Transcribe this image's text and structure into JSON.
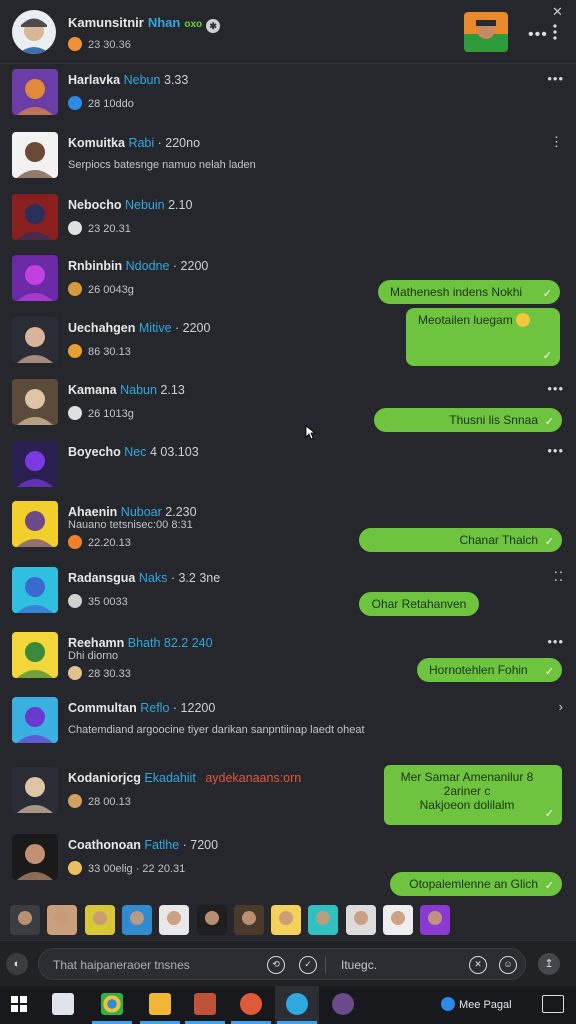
{
  "header": {
    "name": "Kamunsitnir",
    "name_highlight": "Nhan",
    "badge": "oxo",
    "subtitle": "23 30.36",
    "more": "•••",
    "close": "✕"
  },
  "conversations": [
    {
      "name": "Harlavka",
      "highlight": "Nebun",
      "time": "3.33",
      "preview": "28 10ddo",
      "color_a": "#6a3ea6",
      "color_b": "#e08a3a",
      "icon_color": "#2d8ae6",
      "more": "•••"
    },
    {
      "name": "Komuitka",
      "highlight": "Rabi",
      "time": "· 220no",
      "preview": "Serpiocs batesnge namuo nelah laden",
      "color_a": "#f2f2f2",
      "color_b": "#6b4a35",
      "icon_color": "",
      "more": "⋮"
    },
    {
      "name": "Nebocho",
      "highlight": "Nebuin",
      "time": "2.10",
      "preview": "23 20.31",
      "color_a": "#8a1f1f",
      "color_b": "#2c2f5e",
      "icon_color": "#e0e0e0",
      "more": ""
    },
    {
      "name": "Rnbinbin",
      "highlight": "Ndodne",
      "time": "· 2200",
      "preview": "26 0043g",
      "color_a": "#6a2aa6",
      "color_b": "#c040e0",
      "icon_color": "#d79a3a",
      "more": ""
    },
    {
      "name": "Uechahgen",
      "highlight": "Mitive",
      "time": "· 2200",
      "preview": "86 30.13",
      "color_a": "#2a2d35",
      "color_b": "#d9b49a",
      "icon_color": "#e8a030",
      "more": ""
    },
    {
      "name": "Kamana",
      "highlight": "Nabun",
      "time": "2.13",
      "preview": "26 1013g",
      "color_a": "#5c4a3a",
      "color_b": "#e0c4a8",
      "icon_color": "#e0e0e0",
      "more": "•••"
    },
    {
      "name": "Boyecho",
      "highlight": "Nec",
      "time": "4 03.103",
      "preview": "",
      "color_a": "#2a2050",
      "color_b": "#7a3ae0",
      "icon_color": "",
      "more": "•••"
    },
    {
      "name": "Ahaenin",
      "highlight": "Nuboar",
      "time": "2.230",
      "preview": "22.20.13",
      "sub2": "Nauano tetsnisec:00 8:31",
      "color_a": "#f2cf2a",
      "color_b": "#6b4a8a",
      "icon_color": "#f0802a",
      "more": ""
    },
    {
      "name": "Radansgua",
      "highlight": "Naks",
      "time": "· 3.2 3ne",
      "preview": "35 0033",
      "color_a": "#2fc0e0",
      "color_b": "#3a6ad0",
      "icon_color": "#d0d0d0",
      "more": "⁚⁚"
    },
    {
      "name": "Reehamn",
      "highlight": "Bhath 82.2 240",
      "time": "",
      "preview": "28 30.33",
      "sub2": "Dhi diorno",
      "color_a": "#f2d63a",
      "color_b": "#3a8a3a",
      "icon_color": "#e0c090",
      "more": "•••"
    },
    {
      "name": "Commultan",
      "highlight": "Reflo",
      "time": "· 12200",
      "preview": "Chatemdiand argoocine tiyer darikan sanpntiinap laedt oheat",
      "color_a": "#3ab0e0",
      "color_b": "#6a3ad0",
      "icon_color": "",
      "more": "›"
    },
    {
      "name": "Kodaniorjcg",
      "highlight": "Ekadahiit",
      "time": "",
      "preview": "28 00.13",
      "extra": "aydekanaans:orn",
      "color_a": "#2a2d35",
      "color_b": "#e0c4a8",
      "icon_color": "#d0a060",
      "more": ""
    },
    {
      "name": "Coathonoan",
      "highlight": "Fatlhe",
      "time": "· 7200",
      "preview": "33 00elig · 22 20.31",
      "color_a": "#1a1a1a",
      "color_b": "#c09070",
      "icon_color": "#e8c060",
      "more": ""
    }
  ],
  "bubbles": [
    {
      "text": "Mathenesh indens Nokhi",
      "check": "✓"
    },
    {
      "text": "Meotailen luegam",
      "check": "✓"
    },
    {
      "text": "Thusni lis Snnaa",
      "check": "✓"
    },
    {
      "text": "Chanar Thalch",
      "check": "✓"
    },
    {
      "text": "Ohar Retahanven",
      "check": ""
    },
    {
      "text": "Hornotehlen Fohin",
      "check": "✓"
    },
    {
      "text": "Mer Samar Amenanilur 8",
      "line2": "2ariner c",
      "line3": "Nakjoeon dolilalm",
      "check": "✓"
    },
    {
      "text": "Otopalemlenne an Glich",
      "check": "✓"
    }
  ],
  "input": {
    "placeholder": "That haipaneraoer tnsnes",
    "secondary": "Ituegc."
  },
  "taskbar": {
    "tray_text": "Mee Pagal"
  }
}
